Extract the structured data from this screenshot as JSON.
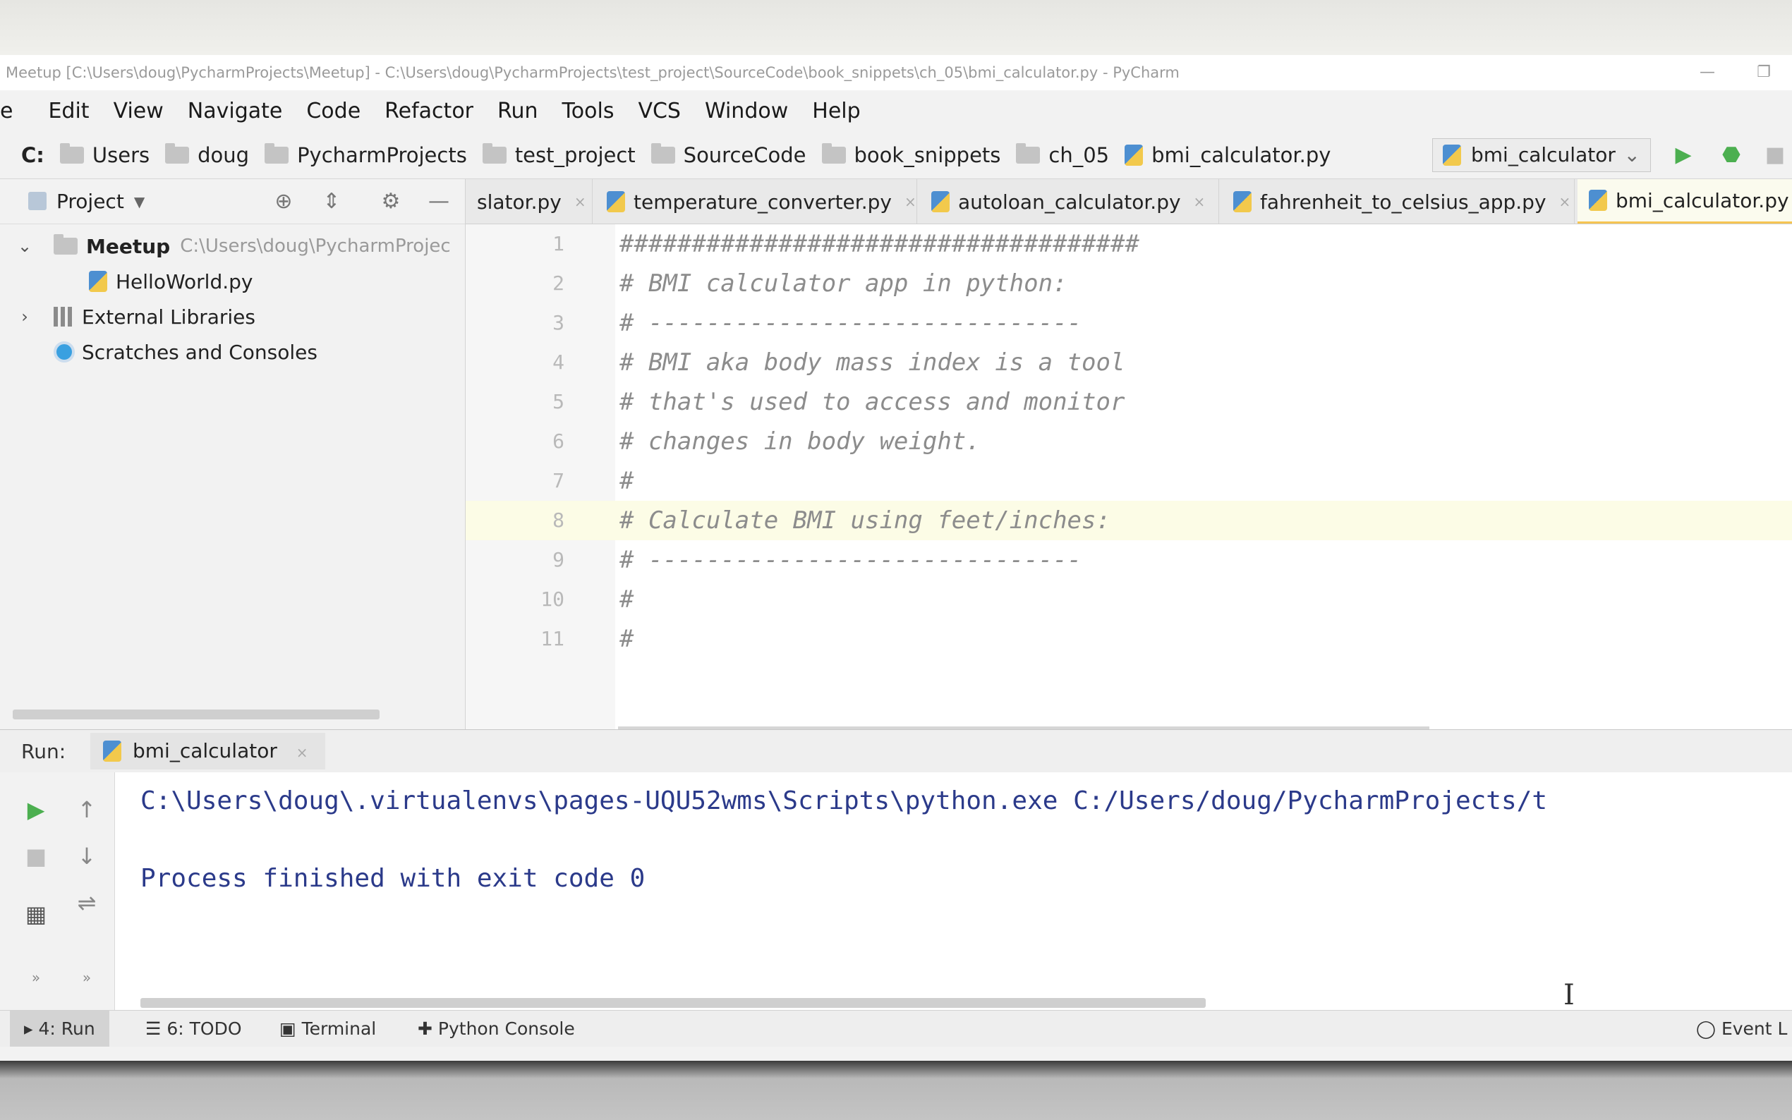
{
  "window": {
    "title": "Meetup [C:\\Users\\doug\\PycharmProjects\\Meetup] - C:\\Users\\doug\\PycharmProjects\\test_project\\SourceCode\\book_snippets\\ch_05\\bmi_calculator.py - PyCharm",
    "minimize": "—",
    "maximize": "❐"
  },
  "menu": [
    "e",
    "Edit",
    "View",
    "Navigate",
    "Code",
    "Refactor",
    "Run",
    "Tools",
    "VCS",
    "Window",
    "Help"
  ],
  "breadcrumbs": {
    "drive": "C:",
    "folders": [
      "Users",
      "doug",
      "PycharmProjects",
      "test_project",
      "SourceCode",
      "book_snippets",
      "ch_05"
    ],
    "file": "bmi_calculator.py"
  },
  "run_config": {
    "name": "bmi_calculator",
    "run_icon": "▶",
    "debug_icon": "⬣"
  },
  "project": {
    "title": "Project",
    "tree": [
      {
        "label": "Meetup",
        "path": "C:\\Users\\doug\\PycharmProjec"
      },
      {
        "label": "HelloWorld.py"
      },
      {
        "label": "External Libraries"
      },
      {
        "label": "Scratches and Consoles"
      }
    ]
  },
  "tabs": [
    {
      "label": "slator.py"
    },
    {
      "label": "temperature_converter.py"
    },
    {
      "label": "autoloan_calculator.py"
    },
    {
      "label": "fahrenheit_to_celsius_app.py"
    },
    {
      "label": "bmi_calculator.py"
    }
  ],
  "editor": {
    "current_line": 8,
    "lines": [
      {
        "n": "1",
        "text": "####################################"
      },
      {
        "n": "2",
        "text": "# BMI calculator app in python:"
      },
      {
        "n": "3",
        "text": "# ------------------------------"
      },
      {
        "n": "4",
        "text": "# BMI aka body mass index is a tool"
      },
      {
        "n": "5",
        "text": "# that's used to access and monitor"
      },
      {
        "n": "6",
        "text": "# changes in body weight."
      },
      {
        "n": "7",
        "text": "#"
      },
      {
        "n": "8",
        "text": "# Calculate BMI using feet/inches:"
      },
      {
        "n": "9",
        "text": "# ------------------------------"
      },
      {
        "n": "10",
        "text": "#"
      },
      {
        "n": "11",
        "text": "#"
      }
    ]
  },
  "run_panel": {
    "label": "Run:",
    "tab": "bmi_calculator",
    "console": [
      "C:\\Users\\doug\\.virtualenvs\\pages-UQU52wms\\Scripts\\python.exe C:/Users/doug/PycharmProjects/t",
      "",
      "Process finished with exit code 0"
    ]
  },
  "tool_strip": {
    "run": "4: Run",
    "todo": "6: TODO",
    "terminal": "Terminal",
    "python_console": "Python Console",
    "event_log": "Event L"
  },
  "colors": {
    "run_green": "#4caf50",
    "tab_active_underline": "#f5c452",
    "console_text": "#2b3a8a"
  }
}
